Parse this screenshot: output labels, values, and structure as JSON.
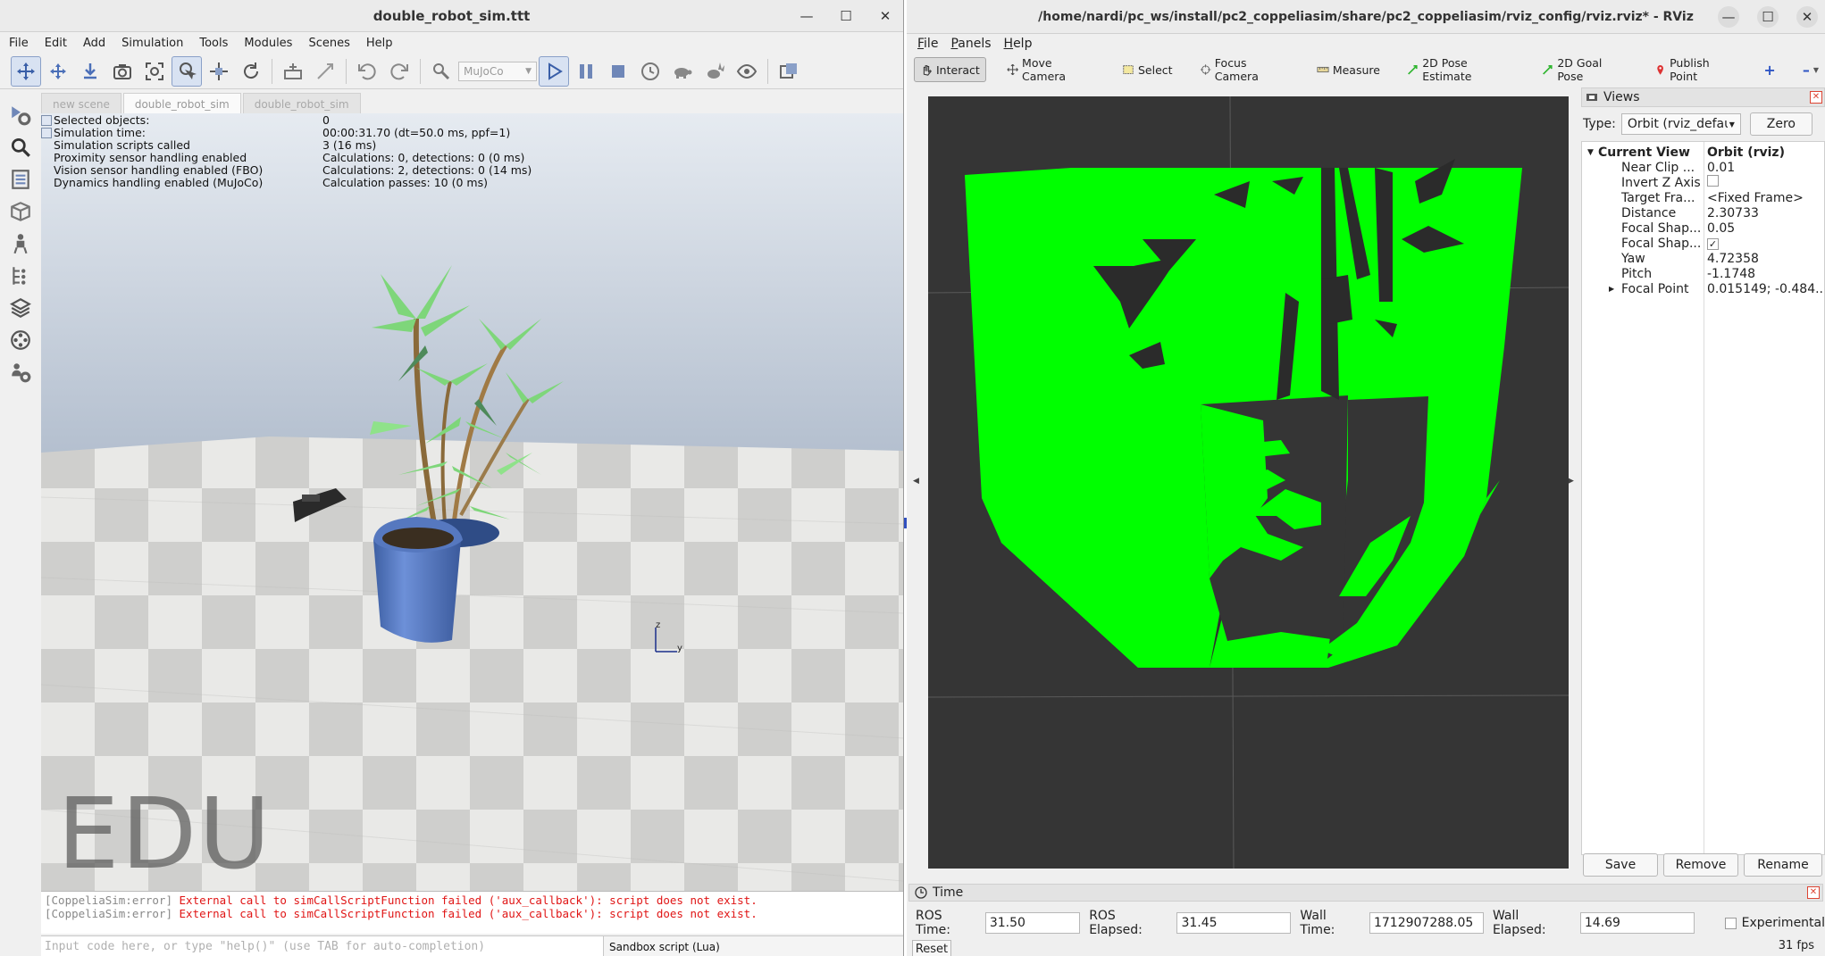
{
  "left_window": {
    "title": "double_robot_sim.ttt",
    "menu": [
      "File",
      "Edit",
      "Add",
      "Simulation",
      "Tools",
      "Modules",
      "Scenes",
      "Help"
    ],
    "physics_engine": "MuJoCo",
    "tabs": [
      "new scene",
      "double_robot_sim",
      "double_robot_sim"
    ],
    "info": [
      {
        "key": "Selected objects:",
        "value": "0"
      },
      {
        "key": "Simulation time:",
        "value": "00:00:31.70 (dt=50.0 ms, ppf=1)"
      },
      {
        "key": "Simulation scripts called",
        "value": "3 (16 ms)"
      },
      {
        "key": "Proximity sensor handling enabled",
        "value": "Calculations: 0, detections: 0 (0 ms)"
      },
      {
        "key": "Vision sensor handling enabled (FBO)",
        "value": "Calculations: 2, detections: 0 (14 ms)"
      },
      {
        "key": "Dynamics handling enabled (MuJoCo)",
        "value": "Calculation passes: 10 (0 ms)"
      }
    ],
    "watermark": "EDU",
    "axis_labels": {
      "z": "z",
      "y": "y"
    },
    "console": [
      {
        "tag": "[CoppeliaSim:error]",
        "msg": "External call to simCallScriptFunction failed ('aux_callback'): script does not exist."
      },
      {
        "tag": "[CoppeliaSim:error]",
        "msg": "External call to simCallScriptFunction failed ('aux_callback'): script does not exist."
      }
    ],
    "command_placeholder": "Input code here, or type \"help()\" (use TAB for auto-completion)",
    "script_selector": "Sandbox script (Lua)"
  },
  "right_window": {
    "title": "/home/nardi/pc_ws/install/pc2_coppeliasim/share/pc2_coppeliasim/rviz_config/rviz.rviz* - RViz",
    "menu": [
      "File",
      "Panels",
      "Help"
    ],
    "tools": [
      "Interact",
      "Move Camera",
      "Select",
      "Focus Camera",
      "Measure",
      "2D Pose Estimate",
      "2D Goal Pose",
      "Publish Point"
    ],
    "views_panel": {
      "title": "Views",
      "type_label": "Type:",
      "type_value": "Orbit (rviz_default_plugins)",
      "zero": "Zero",
      "current_view": "Current View",
      "current_view_value": "Orbit (rviz)",
      "props": [
        {
          "k": "Near Clip ...",
          "v": "0.01"
        },
        {
          "k": "Invert Z Axis",
          "v": ""
        },
        {
          "k": "Target Fra...",
          "v": "<Fixed Frame>"
        },
        {
          "k": "Distance",
          "v": "2.30733"
        },
        {
          "k": "Focal Shap...",
          "v": "0.05"
        },
        {
          "k": "Focal Shap...",
          "v": ""
        },
        {
          "k": "Yaw",
          "v": "4.72358"
        },
        {
          "k": "Pitch",
          "v": "-1.1748"
        },
        {
          "k": "Focal Point",
          "v": "0.015149; -0.484..."
        }
      ],
      "invert_z_checked": false,
      "focal_shape_fixed_checked": true,
      "buttons": [
        "Save",
        "Remove",
        "Rename"
      ]
    },
    "time_panel": {
      "title": "Time",
      "ros_time_label": "ROS Time:",
      "ros_time": "31.50",
      "ros_elapsed_label": "ROS Elapsed:",
      "ros_elapsed": "31.45",
      "wall_time_label": "Wall Time:",
      "wall_time": "1712907288.05",
      "wall_elapsed_label": "Wall Elapsed:",
      "wall_elapsed": "14.69",
      "experimental": "Experimental",
      "reset": "Reset",
      "fps": "31 fps"
    },
    "colors": {
      "pointcloud": "#00ff00",
      "viewport_bg": "#353535"
    }
  }
}
